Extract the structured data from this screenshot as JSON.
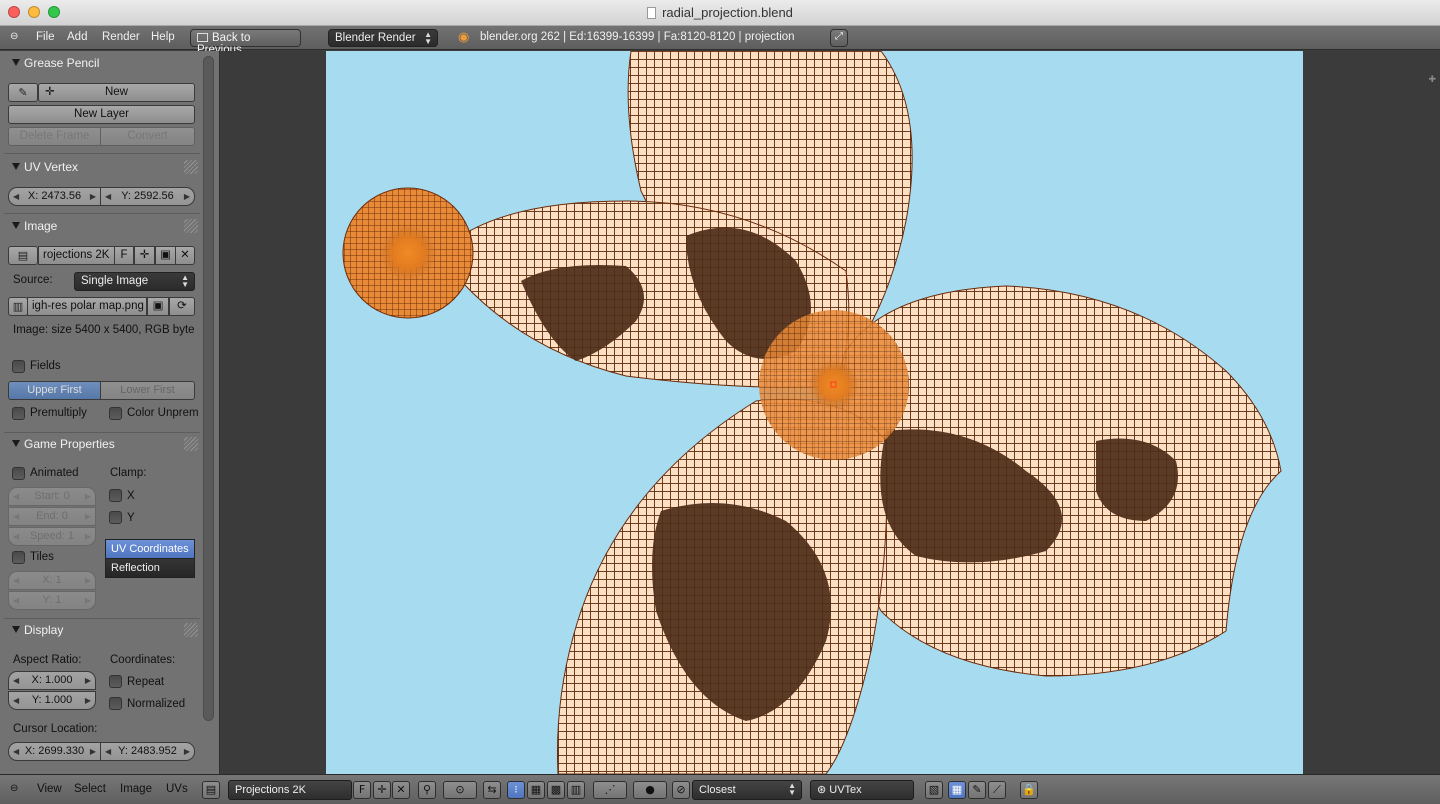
{
  "window": {
    "title": "radial_projection.blend"
  },
  "header": {
    "menus": [
      "File",
      "Add",
      "Render",
      "Help"
    ],
    "back_button": "Back to Previous",
    "render_engine": "Blender Render",
    "stats": "blender.org 262 | Ed:16399-16399 | Fa:8120-8120 | projection"
  },
  "panel": {
    "grease_pencil": {
      "title": "Grease Pencil",
      "new_label": "New",
      "new_layer_label": "New Layer",
      "delete_frame_label": "Delete Frame",
      "convert_label": "Convert"
    },
    "uv_vertex": {
      "title": "UV Vertex",
      "x": "X: 2473.56",
      "y": "Y: 2592.56"
    },
    "image": {
      "title": "Image",
      "image_name": "rojections 2K",
      "fake_user": "F",
      "source_label": "Source:",
      "source_value": "Single Image",
      "filepath": "igh-res polar map.png",
      "info": "Image: size 5400 x 5400, RGB byte",
      "fields_label": "Fields",
      "upper_first": "Upper First",
      "lower_first": "Lower First",
      "premultiply_label": "Premultiply",
      "color_unprem_label": "Color Unprem"
    },
    "game_properties": {
      "title": "Game Properties",
      "animated_label": "Animated",
      "clamp_label": "Clamp:",
      "clamp_x": "X",
      "clamp_y": "Y",
      "start": "Start: 0",
      "end": "End: 0",
      "speed": "Speed: 1",
      "tiles_label": "Tiles",
      "tiles_x": "X: 1",
      "tiles_y": "Y: 1",
      "mapping_options": [
        "UV Coordinates",
        "Reflection"
      ]
    },
    "display": {
      "title": "Display",
      "aspect_label": "Aspect Ratio:",
      "coords_label": "Coordinates:",
      "aspect_x": "X: 1.000",
      "aspect_y": "Y: 1.000",
      "repeat_label": "Repeat",
      "normalized_label": "Normalized",
      "cursor_label": "Cursor Location:",
      "cursor_x": "X: 2699.330",
      "cursor_y": "Y: 2483.952"
    }
  },
  "footer": {
    "menus": [
      "View",
      "Select",
      "Image",
      "UVs"
    ],
    "image_name": "Projections 2K",
    "fake_user": "F",
    "sticky_mode": "Closest",
    "uv_map": "UVTex"
  },
  "colors": {
    "canvas_bg": "#a7dcf0",
    "mesh_fill": "#fde0c4",
    "mesh_lines": "#5a2a0a",
    "land": "#4d2c18",
    "pole_highlight": "#f08a24",
    "accent_blue": "#5678a8"
  }
}
